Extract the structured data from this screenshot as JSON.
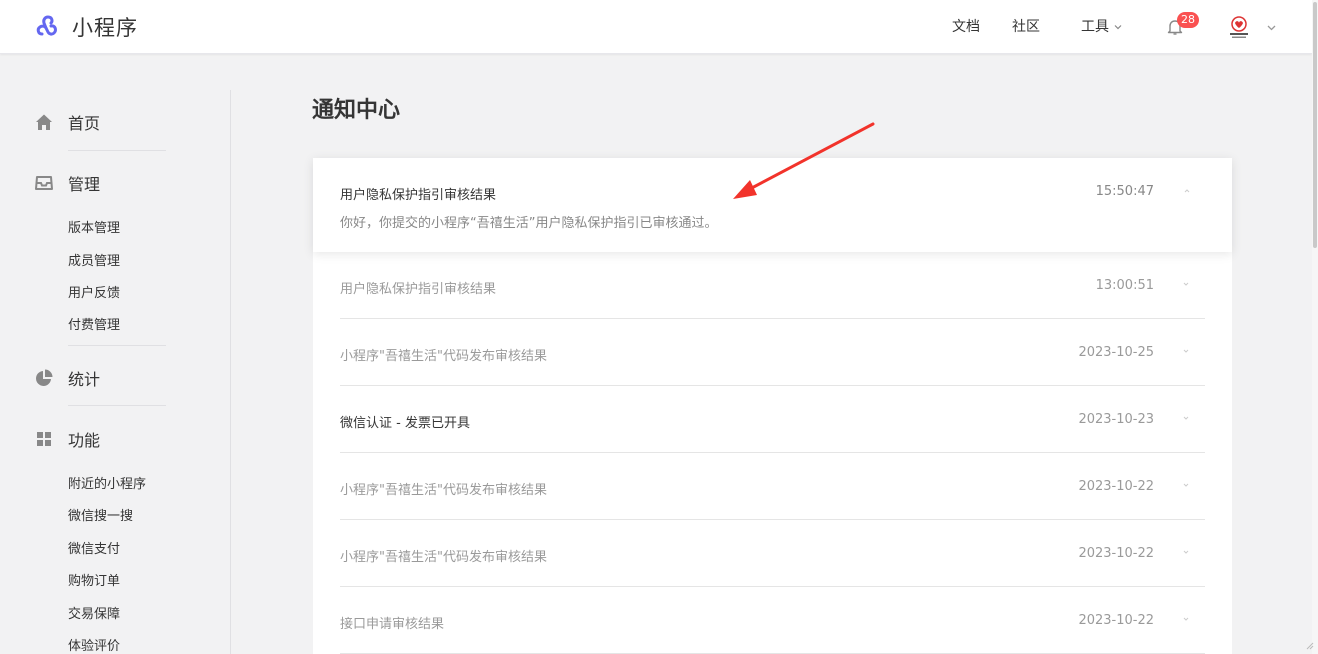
{
  "app": {
    "title": "小程序"
  },
  "nav": {
    "docs": "文档",
    "community": "社区",
    "tools": "工具",
    "notification_count": "28"
  },
  "sidebar": {
    "home": "首页",
    "manage": "管理",
    "manage_items": [
      "版本管理",
      "成员管理",
      "用户反馈",
      "付费管理"
    ],
    "stats": "统计",
    "features": "功能",
    "feature_items": [
      "附近的小程序",
      "微信搜一搜",
      "微信支付",
      "购物订单",
      "交易保障",
      "体验评价"
    ]
  },
  "main": {
    "title": "通知中心",
    "active_notification": {
      "title": "用户隐私保护指引审核结果",
      "time": "15:50:47",
      "body": "你好，你提交的小程序“吾禧生活”用户隐私保护指引已审核通过。"
    },
    "notifications": [
      {
        "title": "用户隐私保护指引审核结果",
        "time": "13:00:51",
        "read": true
      },
      {
        "title": "小程序\"吾禧生活\"代码发布审核结果",
        "time": "2023-10-25",
        "read": true
      },
      {
        "title": "微信认证 - 发票已开具",
        "time": "2023-10-23",
        "read": false
      },
      {
        "title": "小程序\"吾禧生活\"代码发布审核结果",
        "time": "2023-10-22",
        "read": true
      },
      {
        "title": "小程序\"吾禧生活\"代码发布审核结果",
        "time": "2023-10-22",
        "read": true
      },
      {
        "title": "接口申请审核结果",
        "time": "2023-10-22",
        "read": true
      }
    ]
  },
  "colors": {
    "accent": "#576b95",
    "logo": "#6467f0",
    "badge": "#fa5151",
    "annotation_arrow": "#f2332b"
  },
  "icons": [
    "home-icon",
    "inbox-icon",
    "pie-chart-icon",
    "grid-icon",
    "bell-icon",
    "chevron-down-icon",
    "chevron-up-icon"
  ]
}
